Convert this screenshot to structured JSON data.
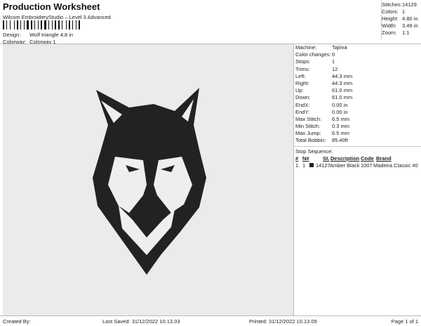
{
  "header": {
    "title": "Production Worksheet",
    "subtitle": "Wilcom EmbroideryStudio – Level 3 Advanced",
    "design_label": "Design:",
    "design": "Wolf triangle 4,8 in",
    "colorway_label": "Colorway:",
    "colorway": "Colorway 1"
  },
  "summary": [
    {
      "k": "Stitches:",
      "v": "14129"
    },
    {
      "k": "Colors:",
      "v": "1"
    },
    {
      "k": "Height:",
      "v": "4.80 in"
    },
    {
      "k": "Width:",
      "v": "3.49 in"
    },
    {
      "k": "Zoom:",
      "v": "1:1"
    }
  ],
  "details": [
    {
      "k": "Machine:",
      "v": "Tajima"
    },
    {
      "k": "Color changes:",
      "v": "0"
    },
    {
      "k": "Stops:",
      "v": "1"
    },
    {
      "k": "Trims:",
      "v": "12"
    },
    {
      "k": "Left:",
      "v": "44.3 mm"
    },
    {
      "k": "Right:",
      "v": "44.3 mm"
    },
    {
      "k": "Up:",
      "v": "61.0 mm"
    },
    {
      "k": "Down:",
      "v": "61.0 mm"
    },
    {
      "k": "EndX:",
      "v": "0.00 in"
    },
    {
      "k": "EndY:",
      "v": "0.00 in"
    },
    {
      "k": "Max Stitch:",
      "v": "6.5 mm"
    },
    {
      "k": "Min Stitch:",
      "v": "0.3 mm"
    },
    {
      "k": "Max Jump:",
      "v": "6.5 mm"
    },
    {
      "k": "Total Bobbin:",
      "v": "85.40ft"
    }
  ],
  "stop_sequence": {
    "title": "Stop Sequence:",
    "headers": [
      "#",
      "N#",
      "St.",
      "Description",
      "Code",
      "Brand"
    ],
    "rows": [
      {
        "num": "1.",
        "n": "1",
        "swatch": "#222222",
        "st": "14127",
        "desc": "Amber Black",
        "code": "1007",
        "brand": "Madeira Classic 40"
      }
    ]
  },
  "footer": {
    "created": "Created By:",
    "saved": "Last Saved: 31/12/2022 10.13.03",
    "printed": "Printed: 31/12/2022 10.13.09",
    "page": "Page 1 of 1"
  }
}
